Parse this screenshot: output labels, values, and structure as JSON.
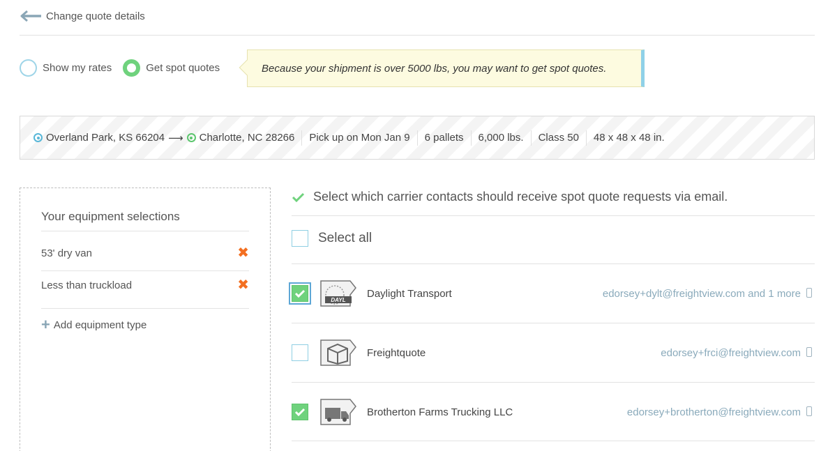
{
  "nav": {
    "back_label": "Change quote details"
  },
  "rate_options": [
    {
      "label": "Show my rates",
      "selected": false
    },
    {
      "label": "Get spot quotes",
      "selected": true
    }
  ],
  "tip": {
    "text": "Because your shipment is over 5000 lbs, you may want to get spot quotes."
  },
  "summary": {
    "origin": "Overland Park, KS 66204",
    "destination": "Charlotte, NC 28266",
    "pickup": "Pick up on Mon Jan 9",
    "pallets": "6 pallets",
    "weight": "6,000 lbs.",
    "freight_class": "Class 50",
    "dimensions": "48 x 48 x 48 in."
  },
  "equipment": {
    "title": "Your equipment selections",
    "items": [
      {
        "label": "53' dry van"
      },
      {
        "label": "Less than truckload"
      }
    ],
    "add_label": "Add equipment type"
  },
  "carriers_section": {
    "instruction": "Select which carrier contacts should receive spot quote requests via email.",
    "select_all_label": "Select all",
    "select_all_checked": false,
    "carriers": [
      {
        "name": "Daylight Transport",
        "email": "edorsey+dylt@freightview.com and 1 more",
        "checked": true,
        "logo": "daylight-logo"
      },
      {
        "name": "Freightquote",
        "email": "edorsey+frci@freightview.com",
        "checked": false,
        "logo": "box-logo"
      },
      {
        "name": "Brotherton Farms Trucking LLC",
        "email": "edorsey+brotherton@freightview.com",
        "checked": true,
        "logo": "truck-logo"
      }
    ]
  },
  "colors": {
    "accent_green": "#6fd27d",
    "accent_blue": "#8fcfe3",
    "remove_orange": "#f36f21",
    "tip_background": "#fdfbe0"
  }
}
